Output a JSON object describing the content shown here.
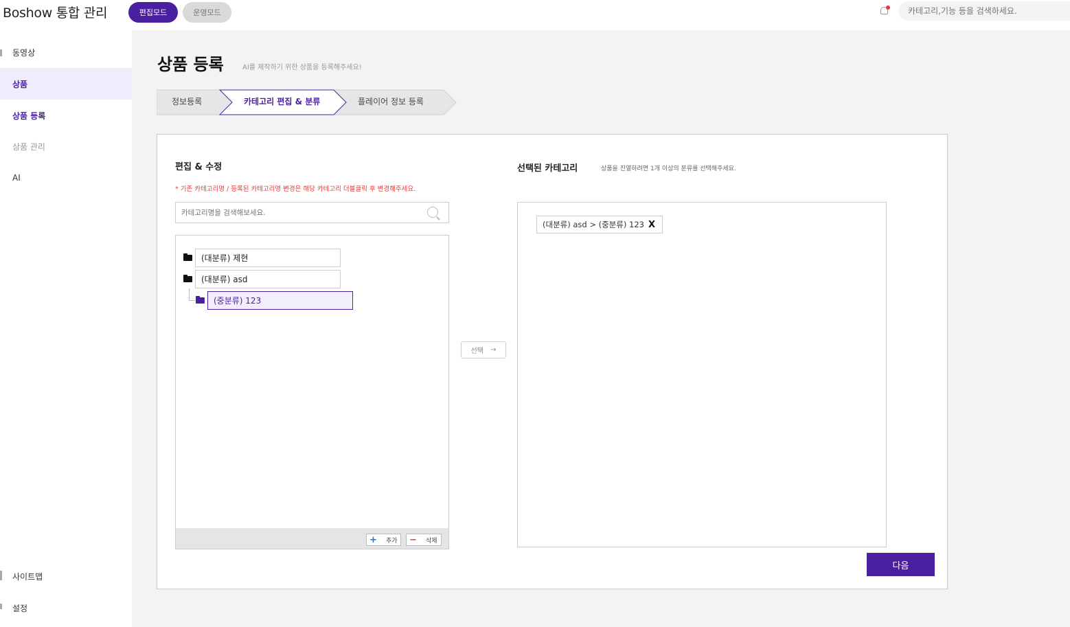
{
  "header": {
    "app_title": "Boshow 통합 관리",
    "mode_edit_label": "편집모드",
    "mode_ops_label": "운영모드",
    "search_placeholder": "카테고리,기능 등을 검색하세요."
  },
  "sidebar": {
    "items": [
      {
        "label": "동영상"
      },
      {
        "label": "상품"
      },
      {
        "label": "상품 등록"
      },
      {
        "label": "상품 관리"
      },
      {
        "label": "AI"
      }
    ],
    "bottom_items": [
      {
        "label": "사이트맵"
      },
      {
        "label": "설정"
      }
    ]
  },
  "page": {
    "title": "상품 등록",
    "subtitle": "AI를 제작하기 위한 상품을 등록해주세요!"
  },
  "steps": [
    {
      "label": "정보등록",
      "active": false
    },
    {
      "label": "카테고리 편집 & 분류",
      "active": true
    },
    {
      "label": "플레이어 정보 등록",
      "active": false
    }
  ],
  "editor": {
    "title": "편집 & 수정",
    "warning": "* 기존 카테고리명 / 등록된 카테고리명 변경은 해당 카테고리 더블클릭 후 변경해주세요.",
    "search_placeholder": "카테고리명을 검색해보세요.",
    "tree": [
      {
        "label": "(대분류) 제현",
        "level": 0,
        "selected": false
      },
      {
        "label": "(대분류) asd",
        "level": 0,
        "selected": false
      },
      {
        "label": "(중분류) 123",
        "level": 1,
        "selected": true
      }
    ],
    "add_label": "추가",
    "delete_label": "삭제"
  },
  "transfer": {
    "select_label": "선택",
    "arrow": "→"
  },
  "selected": {
    "title": "선택된 카테고리",
    "note": "상품을 진열하려면 1개 이상의 분류를 선택해주세요.",
    "chips": [
      {
        "label": "(대분류) asd > (중분류) 123",
        "remove": "X"
      }
    ]
  },
  "footer": {
    "next_label": "다음"
  },
  "colors": {
    "accent": "#4a1fa0",
    "warning": "#e53935",
    "active_bg": "#f1ecfb"
  }
}
